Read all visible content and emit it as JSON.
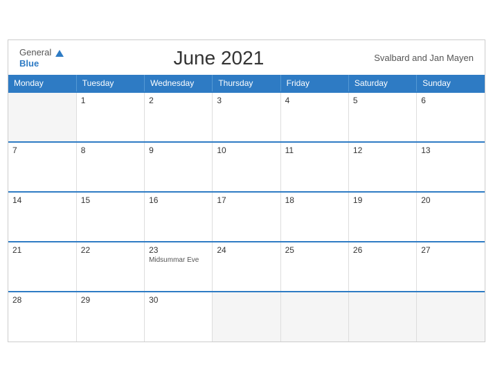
{
  "header": {
    "logo_general": "General",
    "logo_blue": "Blue",
    "title": "June 2021",
    "region": "Svalbard and Jan Mayen"
  },
  "weekdays": [
    "Monday",
    "Tuesday",
    "Wednesday",
    "Thursday",
    "Friday",
    "Saturday",
    "Sunday"
  ],
  "weeks": [
    [
      {
        "day": "",
        "empty": true
      },
      {
        "day": "1",
        "empty": false
      },
      {
        "day": "2",
        "empty": false
      },
      {
        "day": "3",
        "empty": false
      },
      {
        "day": "4",
        "empty": false
      },
      {
        "day": "5",
        "empty": false
      },
      {
        "day": "6",
        "empty": false
      }
    ],
    [
      {
        "day": "7",
        "empty": false
      },
      {
        "day": "8",
        "empty": false
      },
      {
        "day": "9",
        "empty": false
      },
      {
        "day": "10",
        "empty": false
      },
      {
        "day": "11",
        "empty": false
      },
      {
        "day": "12",
        "empty": false
      },
      {
        "day": "13",
        "empty": false
      }
    ],
    [
      {
        "day": "14",
        "empty": false
      },
      {
        "day": "15",
        "empty": false
      },
      {
        "day": "16",
        "empty": false
      },
      {
        "day": "17",
        "empty": false
      },
      {
        "day": "18",
        "empty": false
      },
      {
        "day": "19",
        "empty": false
      },
      {
        "day": "20",
        "empty": false
      }
    ],
    [
      {
        "day": "21",
        "empty": false
      },
      {
        "day": "22",
        "empty": false
      },
      {
        "day": "23",
        "empty": false,
        "event": "Midsummar Eve"
      },
      {
        "day": "24",
        "empty": false
      },
      {
        "day": "25",
        "empty": false
      },
      {
        "day": "26",
        "empty": false
      },
      {
        "day": "27",
        "empty": false
      }
    ],
    [
      {
        "day": "28",
        "empty": false
      },
      {
        "day": "29",
        "empty": false
      },
      {
        "day": "30",
        "empty": false
      },
      {
        "day": "",
        "empty": true
      },
      {
        "day": "",
        "empty": true
      },
      {
        "day": "",
        "empty": true
      },
      {
        "day": "",
        "empty": true
      }
    ]
  ]
}
